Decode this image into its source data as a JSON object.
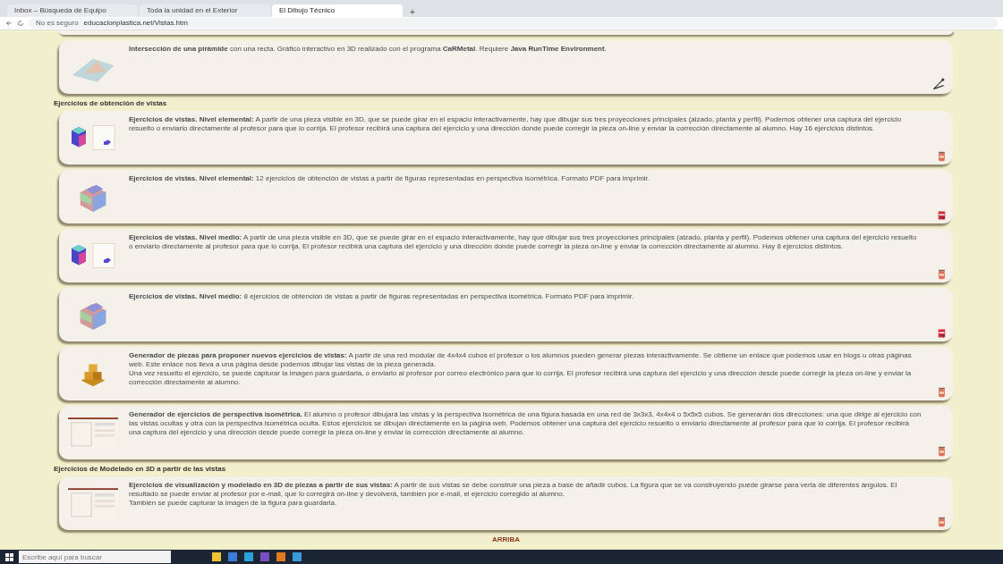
{
  "browser": {
    "tabs": [
      {
        "label": "Inbox – Búsqueda de Equipo",
        "selected": false
      },
      {
        "label": "Toda la unidad en el Exterior",
        "selected": false
      },
      {
        "label": "El Dibujo Técnico",
        "selected": true
      }
    ],
    "new_tab": "+",
    "security": "No es seguro",
    "url": "educacionplastica.net/Vistas.htm"
  },
  "sections": [
    {
      "cards": [
        {
          "kind": "geometry",
          "paragraphs": [
            "**Intersección de una pirámide** con una recta. Gráfico interactivo en 3D realizado con el programa **CaRMetal**. Requiere **Java RunTime Environment**."
          ]
        }
      ]
    },
    {
      "heading": "Ejercicios de obtención de vistas",
      "cards": [
        {
          "kind": "interactive",
          "paragraphs": [
            "**Ejercicios de vistas. Nivel elemental:** A partir de una pieza visible en 3D, que se puede girar en el espacio interactivamente, hay que dibujar sus tres proyecciones principales (alzado, planta y perfil). Podemos obtener una captura del ejercicio resuelto o enviarlo directamente al profesor para que lo corrija. El profesor recibirá una captura del ejercicio y una dirección donde puede corregir la pieza on-line y enviar la corrección directamente al alumno. Hay 16 ejercicios distintos."
          ]
        },
        {
          "kind": "printable",
          "paragraphs": [
            "**Ejercicios de vistas. Nivel elemental:** 12 ejercicios de obtención de vistas a partir de figuras representadas en perspectiva isométrica. Formato PDF para imprimir."
          ]
        },
        {
          "kind": "interactive",
          "paragraphs": [
            "**Ejercicios de vistas. Nivel medio:** A partir de una pieza visible en 3D, que se puede girar en el espacio interactivamente, hay que dibujar sus tres proyecciones principales (alzado, planta y perfil). Podemos obtener una captura del ejercicio resuelto o enviarlo directamente al profesor para que lo corrija. El profesor recibirá una captura del ejercicio y una dirección donde puede corregir la pieza on-line y enviar la corrección directamente al alumno. Hay 8 ejercicios distintos."
          ]
        },
        {
          "kind": "printable",
          "paragraphs": [
            "**Ejercicios de vistas. Nivel medio:** 8 ejercicios de obtención de vistas a partir de figuras representadas en perspectiva isométrica. Formato PDF para imprimir."
          ]
        },
        {
          "kind": "generator",
          "paragraphs": [
            "**Generador de piezas para proponer nuevos ejercicios de vistas:** A partir de una red modular de 4x4x4 cubos el profesor o los alumnos pueden generar piezas interactivamente. Se obtiene un enlace que podemos usar en blogs u otras páginas web. Este enlace nos lleva a una página desde podemos dibujar las vistas de la pieza generada.",
            "Una vez resuelto el ejercicio, se puede capturar la imagen para guardarla, o enviarlo al profesor por correo electrónico para que lo corrija. El profesor recibirá una captura del ejercicio y una dirección desde puede corregir la pieza on-line y enviar la corrección directamente al alumno."
          ]
        },
        {
          "kind": "editor",
          "paragraphs": [
            "**Generador de ejercicios de perspectiva isométrica.** El alumno o profesor dibujará las vistas y la perspectiva isométrica de una figura basada en una red de 3x3x3, 4x4x4 o 5x5x5 cubos. Se generarán dos direcciones: una que dirige al ejercicio con las vistas ocultas y otra con la perspectiva isométrica oculta. Estos ejercicios se dibujan directamente en la página web. Podemos obtener una captura del ejercicio resuelto o enviarlo directamente al profesor para que lo corrija. El profesor recibirá una captura del ejercicio y una dirección desde puede corregir la pieza on-line y enviar la corrección directamente al alumno."
          ]
        }
      ]
    },
    {
      "heading": "Ejercicios de Modelado en 3D a partir de las vistas",
      "cards": [
        {
          "kind": "modeler",
          "paragraphs": [
            "**Ejercicios de visualización y modelado en 3D de piezas a partir de sus vistas:** A partir de sus vistas se debe construir una pieza a base de añadir cubos. La figura que se va construyendo puede girarse para verla de diferentes ángulos. El resultado se puede enviar al profesor por e-mail, que lo corregirá on-line y devolverá, también por e-mail, el ejercicio corregido al alumno.",
            "También se puede capturar la imagen de la figura para guardarla."
          ]
        }
      ]
    }
  ],
  "top_link": "ARRIBA",
  "taskbar": {
    "search_placeholder": "Escribe aquí para buscar"
  }
}
